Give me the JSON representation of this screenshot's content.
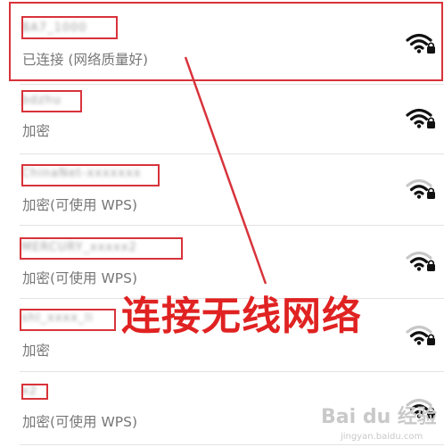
{
  "networks": [
    {
      "ssid": "BA7_1000",
      "status": "已连接 (网络质量好)",
      "signal": "strong",
      "connected": true
    },
    {
      "ssid": "bdzhu",
      "status": "加密",
      "signal": "strong",
      "connected": false
    },
    {
      "ssid": "ChinaNet-xxxxxxx",
      "status": "加密(可使用 WPS)",
      "signal": "medium",
      "connected": false
    },
    {
      "ssid": "MERCURY_xxxxx2",
      "status": "加密(可使用 WPS)",
      "signal": "medium",
      "connected": false
    },
    {
      "ssid": "shl_xxxx_li",
      "status": "加密",
      "signal": "medium",
      "connected": false
    },
    {
      "ssid": "x2",
      "status": "加密(可使用 WPS)",
      "signal": "medium",
      "connected": false
    }
  ],
  "annotation": {
    "text": "连接无线网络"
  },
  "watermark": {
    "text": "Bai du 经验",
    "url": "jingyan.baidu.com"
  },
  "colors": {
    "highlight": "#d8333b",
    "annotation": "#e02222"
  }
}
